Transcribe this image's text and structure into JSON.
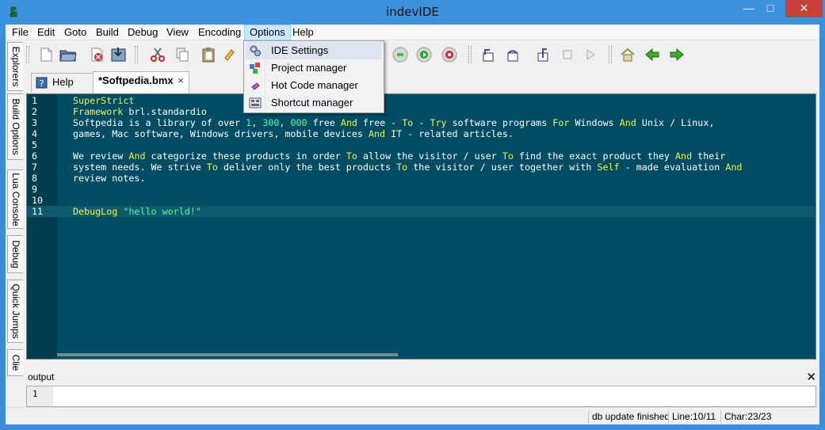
{
  "window": {
    "title": "indevIDE"
  },
  "menubar": [
    "File",
    "Edit",
    "Goto",
    "Build",
    "Debug",
    "View",
    "Encoding",
    "Options",
    "Help"
  ],
  "options_menu": [
    "IDE Settings",
    "Project manager",
    "Hot Code manager",
    "Shortcut manager"
  ],
  "side_tabs": [
    "Explorers",
    "Build Options",
    "Lua Console",
    "Debug",
    "Quick Jumps",
    "Clie"
  ],
  "file_tabs": {
    "help": "Help",
    "active": "*Softpedia.bmx",
    "close": "×"
  },
  "editor": {
    "line_numbers": [
      "1",
      "2",
      "3",
      "4",
      "5",
      "6",
      "7",
      "8",
      "9",
      "10",
      "11"
    ],
    "current_line": 11
  },
  "output": {
    "title": "output",
    "line_number": "1",
    "close": "✕"
  },
  "status": {
    "message": "db update finished",
    "line": "Line:10/11",
    "char": "Char:23/23"
  },
  "colors": {
    "editor_bg": "#004d63",
    "keyword": "#f4f24a",
    "literal": "#52ff9a",
    "titlebar": "#3c92dc"
  },
  "toolbar_icons": [
    "new-file-icon",
    "open-folder-icon",
    "close-file-icon",
    "save-icon",
    "cut-icon",
    "copy-icon",
    "paste-icon",
    "find-icon",
    "build-icon",
    "run-icon",
    "stop-icon",
    "step-in-icon",
    "step-over-icon",
    "step-out-icon",
    "halt-icon",
    "continue-icon",
    "home-icon",
    "back-icon",
    "forward-icon"
  ]
}
